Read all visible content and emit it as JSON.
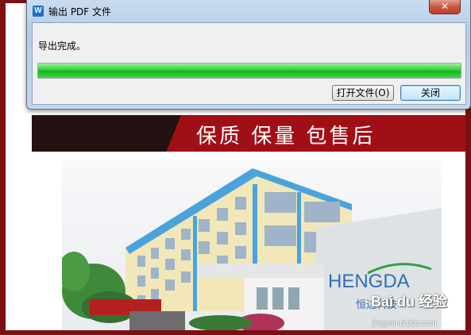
{
  "dialog": {
    "title": "输出 PDF 文件",
    "app_icon_letter": "W",
    "close_glyph": "✕",
    "status_text": "导出完成。",
    "progress": 1.0,
    "buttons": {
      "open_file": "打开文件(O)",
      "close": "关闭"
    }
  },
  "page": {
    "banner_text": "保质 保量 包售后",
    "sign_text": "HENGDA",
    "sign_subtext": "恒达科技"
  },
  "watermark": {
    "brand": "Bai du 经验",
    "url": "jingyan.baidu.com"
  },
  "colors": {
    "frame": "#7a0f14",
    "banner_red": "#a10f16",
    "banner_dark": "#241212",
    "progress_green": "#17b41f",
    "dialog_chrome": "#b7cde6"
  }
}
